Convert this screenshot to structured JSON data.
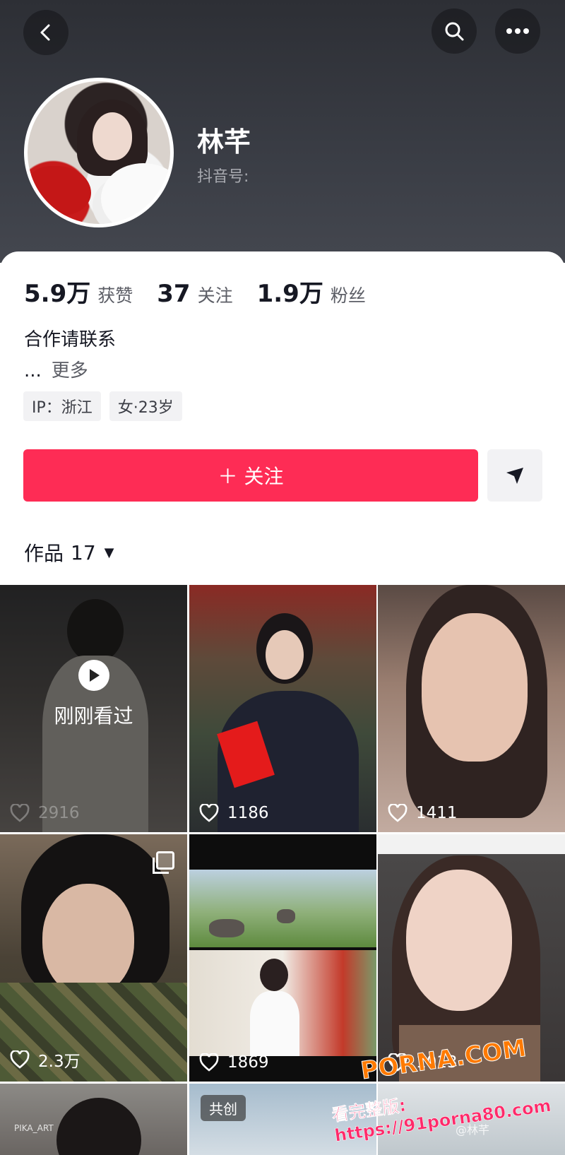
{
  "profile": {
    "name": "林芊",
    "douyin_id_label": "抖音号:",
    "stats": [
      {
        "num": "5.9万",
        "label": "获赞"
      },
      {
        "num": "37",
        "label": "关注"
      },
      {
        "num": "1.9万",
        "label": "粉丝"
      }
    ],
    "bio": "合作请联系",
    "bio_more_dots": "...",
    "bio_more": "更多",
    "tags": [
      "IP：浙江",
      "女·23岁"
    ],
    "follow_label": "＋ 关注"
  },
  "works": {
    "label": "作品",
    "count": "17",
    "caret": "▼"
  },
  "grid": [
    {
      "likes": "2916",
      "seen": true,
      "seen_text": "刚刚看过"
    },
    {
      "likes": "1186"
    },
    {
      "likes": "1411"
    },
    {
      "likes": "2.3万",
      "multi": true
    },
    {
      "likes": "1869"
    },
    {
      "likes": "1013"
    },
    {
      "small_text": "PIKA_ART"
    },
    {
      "badge": "共创"
    },
    {
      "small_text": "@林芊"
    }
  ],
  "watermark": {
    "line1": "PORNA.COM",
    "line2": "看完整版: https://91porna80.com"
  },
  "colors": {
    "accent": "#fe2c55",
    "header_bg": "#2d2f35"
  }
}
